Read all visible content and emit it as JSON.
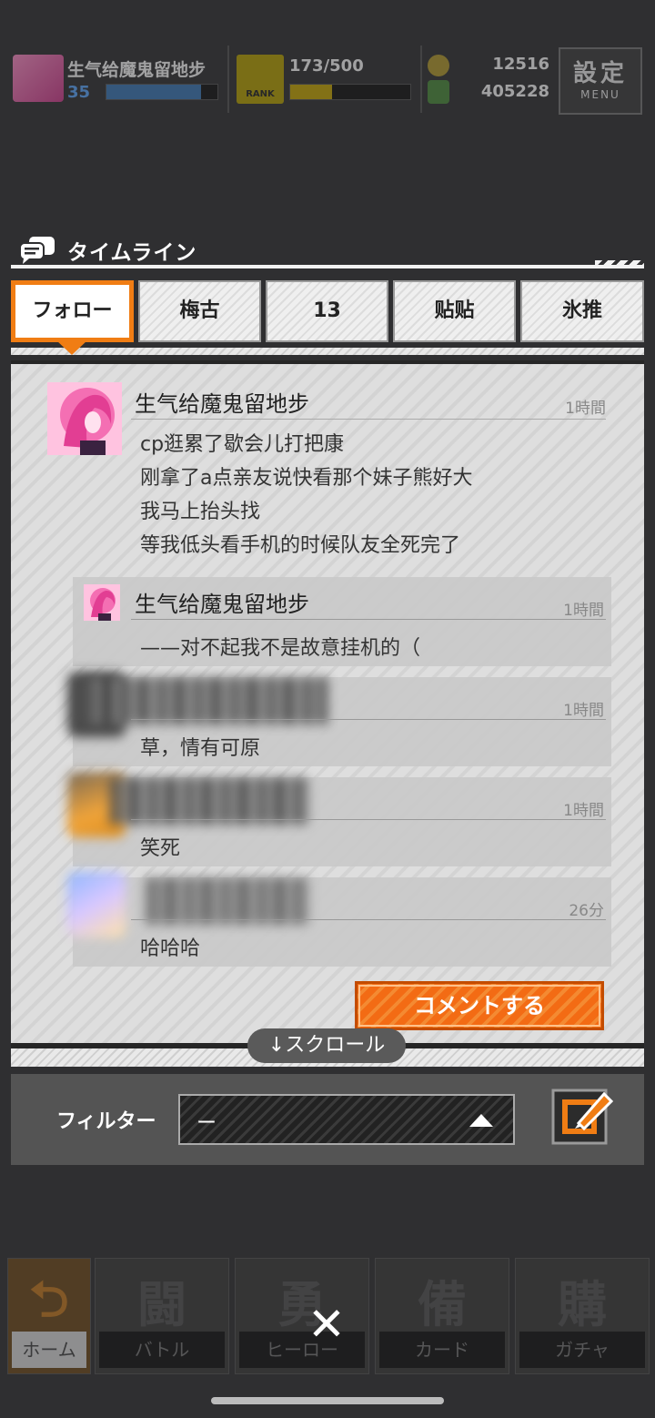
{
  "background": {
    "player": {
      "name": "生气给魔鬼留地步",
      "level": "35",
      "level_progress": 0.85
    },
    "rank": {
      "label": "RANK",
      "exp": "173/500",
      "exp_progress": 0.35
    },
    "currency": {
      "coins": "12516",
      "gems": "405228"
    },
    "settings": {
      "label": "設定",
      "sub": "MENU"
    },
    "nav": [
      {
        "label": "ホーム",
        "glyph": "⮌",
        "icon": "home-icon"
      },
      {
        "label": "バトル",
        "glyph": "闘",
        "icon": "battle-icon"
      },
      {
        "label": "ヒーロー",
        "glyph": "勇",
        "icon": "hero-icon"
      },
      {
        "label": "カード",
        "glyph": "備",
        "icon": "card-icon"
      },
      {
        "label": "ガチャ",
        "glyph": "購",
        "icon": "gacha-icon"
      }
    ]
  },
  "timeline": {
    "title": "タイムライン",
    "tabs": [
      "フォロー",
      "梅古",
      "13",
      "贴贴",
      "氷推"
    ],
    "active_tab": 0,
    "post": {
      "author": "生气给魔鬼留地步",
      "time": "1時間",
      "lines": [
        "cp逛累了歇会儿打把康",
        "刚拿了a点亲友说快看那个妹子熊好大",
        "我马上抬头找",
        "等我低头看手机的时候队友全死完了"
      ]
    },
    "comments": [
      {
        "author": "生气给魔鬼留地步",
        "time": "1時間",
        "text": "——对不起我不是故意挂机的（",
        "blurred": false
      },
      {
        "author": "",
        "time": "1時間",
        "text": "草，情有可原",
        "blurred": true
      },
      {
        "author": "",
        "time": "1時間",
        "text": "笑死",
        "blurred": true
      },
      {
        "author": "",
        "time": "26分",
        "text": "哈哈哈",
        "blurred": true
      }
    ],
    "comment_button": "コメントする",
    "scroll_hint": "↓スクロール",
    "filter": {
      "label": "フィルター",
      "value": "ー"
    },
    "close": "✕",
    "colors": {
      "accent": "#f07d14",
      "panel": "#dedede",
      "text": "#333333"
    }
  }
}
